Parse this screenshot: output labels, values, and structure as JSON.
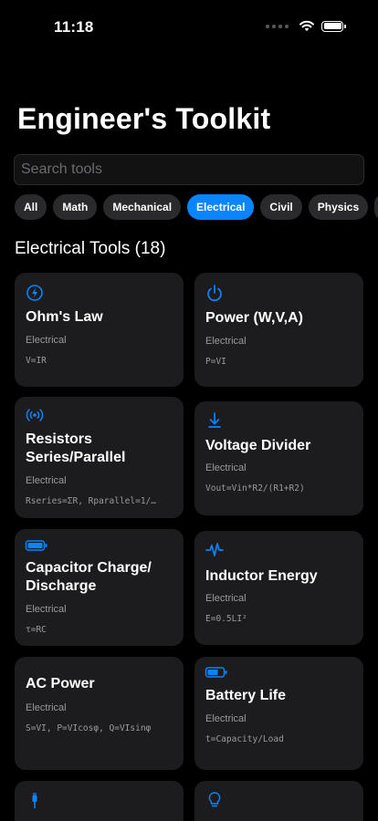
{
  "status": {
    "time": "11:18"
  },
  "title": "Engineer's Toolkit",
  "search": {
    "placeholder": "Search tools",
    "value": ""
  },
  "categories": [
    "All",
    "Math",
    "Mechanical",
    "Electrical",
    "Civil",
    "Physics"
  ],
  "active_category": "Electrical",
  "section_title": "Electrical Tools (18)",
  "accent_color": "#0a84ff",
  "tools": [
    {
      "name": "Ohm's Law",
      "category": "Electrical",
      "formula": "V=IR",
      "icon": "bolt-circle-icon"
    },
    {
      "name": "Power (W,V,A)",
      "category": "Electrical",
      "formula": "P=VI",
      "icon": "power-icon"
    },
    {
      "name": "Resistors Series/Parallel",
      "category": "Electrical",
      "formula": "Rseries=ΣR, Rparallel=1/…",
      "icon": "antenna-broadcast-icon"
    },
    {
      "name": "Voltage Divider",
      "category": "Electrical",
      "formula": "Vout=Vin*R2/(R1+R2)",
      "icon": "arrow-down-to-line-icon"
    },
    {
      "name": "Capacitor Charge/ Discharge",
      "category": "Electrical",
      "formula": "τ=RC",
      "icon": "battery-full-icon"
    },
    {
      "name": "Inductor Energy",
      "category": "Electrical",
      "formula": "E=0.5LI²",
      "icon": "waveform-icon"
    },
    {
      "name": "AC Power",
      "category": "Electrical",
      "formula": "S=VI, P=VIcosφ, Q=VIsinφ",
      "icon": ""
    },
    {
      "name": "Battery Life",
      "category": "Electrical",
      "formula": "t=Capacity/Load",
      "icon": "battery-half-icon"
    },
    {
      "name": "",
      "category": "",
      "formula": "",
      "icon": "cable-connector-icon"
    },
    {
      "name": "",
      "category": "",
      "formula": "",
      "icon": "lightbulb-icon"
    }
  ]
}
